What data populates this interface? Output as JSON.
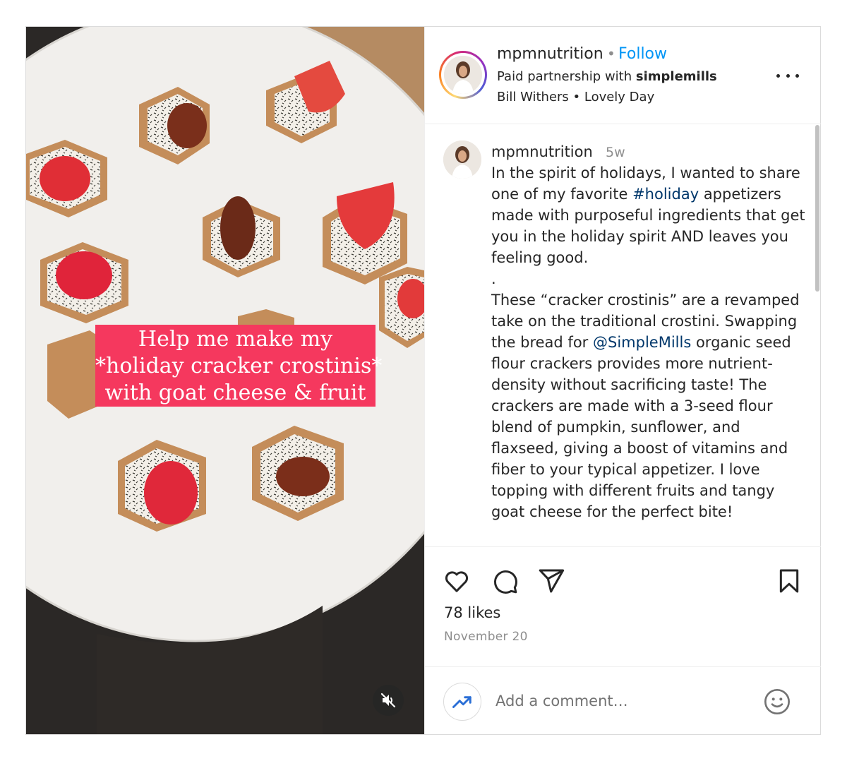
{
  "media": {
    "overlay_lines": [
      "Help me make my",
      "*holiday cracker crostinis*",
      "with goat cheese & fruit"
    ],
    "mute_icon": "speaker-muted-icon"
  },
  "header": {
    "username": "mpmnutrition",
    "separator": "•",
    "follow_label": "Follow",
    "partnership_prefix": "Paid partnership with ",
    "partner": "simplemills",
    "audio": "Bill Withers • Lovely Day",
    "more_icon": "more-options-icon"
  },
  "caption": {
    "username": "mpmnutrition",
    "time": "5w",
    "lines": [
      {
        "text": "In the spirit of holidays, I wanted to share"
      },
      {
        "before": "one of my favorite ",
        "link": "#holiday",
        "after": " appetizers"
      },
      {
        "text": "made with purposeful ingredients that get"
      },
      {
        "text": "you in the holiday spirit AND leaves you"
      },
      {
        "text": "feeling good."
      },
      {
        "text": "."
      },
      {
        "text": "These “cracker crostinis” are a revamped"
      },
      {
        "text": "take on the traditional crostini. Swapping"
      },
      {
        "before": "the bread for ",
        "link": "@SimpleMills",
        "after": " organic seed"
      },
      {
        "text": "flour crackers provides more nutrient-"
      },
      {
        "text": "density without sacrificing taste! The"
      },
      {
        "text": "crackers are made with a 3-seed flour"
      },
      {
        "text": "blend of pumpkin, sunflower, and"
      },
      {
        "text": "flaxseed, giving a boost of vitamins and"
      },
      {
        "text": "fiber to your typical appetizer. I love"
      },
      {
        "text": "topping with different fruits and tangy"
      },
      {
        "text": "goat cheese for the perfect bite!"
      }
    ]
  },
  "actions": {
    "icons": [
      "heart-icon",
      "comment-icon",
      "share-icon",
      "bookmark-icon"
    ],
    "likes": "78 likes",
    "date": "November 20"
  },
  "comment_box": {
    "placeholder": "Add a comment…",
    "left_icon": "trending-icon",
    "emoji_icon": "emoji-icon"
  },
  "colors": {
    "follow": "#0095f6",
    "link": "#00376b",
    "overlay": "#f5385e",
    "muted_text": "#8e8e8e"
  }
}
